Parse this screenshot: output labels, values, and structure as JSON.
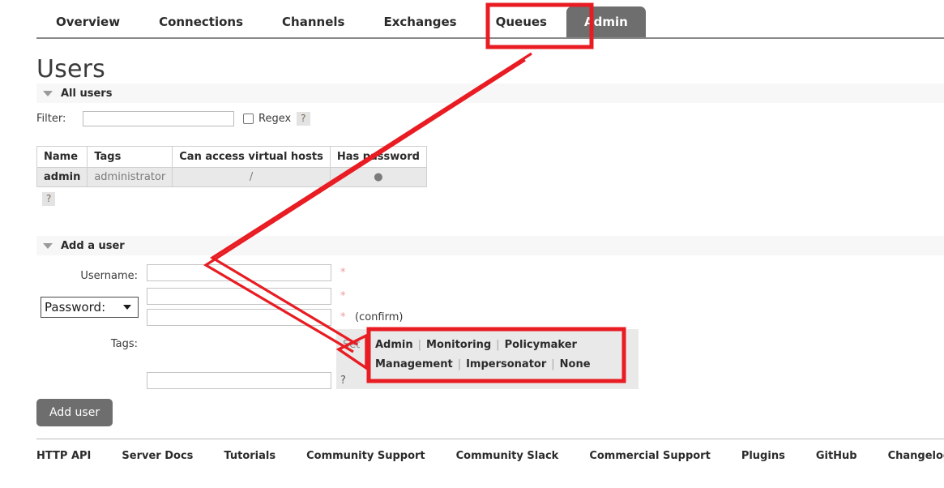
{
  "nav": {
    "items": [
      {
        "label": "Overview",
        "active": false
      },
      {
        "label": "Connections",
        "active": false
      },
      {
        "label": "Channels",
        "active": false
      },
      {
        "label": "Exchanges",
        "active": false
      },
      {
        "label": "Queues",
        "active": false
      },
      {
        "label": "Admin",
        "active": true
      }
    ]
  },
  "page": {
    "title": "Users"
  },
  "all_users": {
    "section_title": "All users",
    "filter_label": "Filter:",
    "filter_value": "",
    "regex_label": "Regex",
    "regex_checked": false,
    "help_label": "?",
    "table": {
      "columns": [
        "Name",
        "Tags",
        "Can access virtual hosts",
        "Has password"
      ],
      "rows": [
        {
          "name": "admin",
          "tags": "administrator",
          "vhosts": "/",
          "has_password": "●"
        }
      ]
    },
    "table_help_label": "?"
  },
  "add_user": {
    "section_title": "Add a user",
    "username_label": "Username:",
    "username_value": "",
    "password_select_label": "Password:",
    "password_value": "",
    "password_confirm_value": "",
    "confirm_text": "(confirm)",
    "required_mark": "*",
    "tags_label": "Tags:",
    "tags_value": "",
    "set_label": "Set",
    "tag_links": [
      "Admin",
      "Monitoring",
      "Policymaker",
      "Management",
      "Impersonator",
      "None"
    ],
    "tag_separator": "|",
    "tags_help_label": "?",
    "submit_label": "Add user"
  },
  "footer": {
    "links": [
      "HTTP API",
      "Server Docs",
      "Tutorials",
      "Community Support",
      "Community Slack",
      "Commercial Support",
      "Plugins",
      "GitHub",
      "Changelog"
    ]
  },
  "annotations": {
    "color": "#e81c22",
    "highlight_boxes": [
      "admin-tab",
      "tag-links-panel"
    ],
    "arrow": "admin-tab-to-tag-links"
  },
  "colors": {
    "accent_dark": "#6e6e6e",
    "annotation_red": "#e81c22",
    "row_gray": "#e9e9e9",
    "section_gray": "#f7f7f7"
  }
}
